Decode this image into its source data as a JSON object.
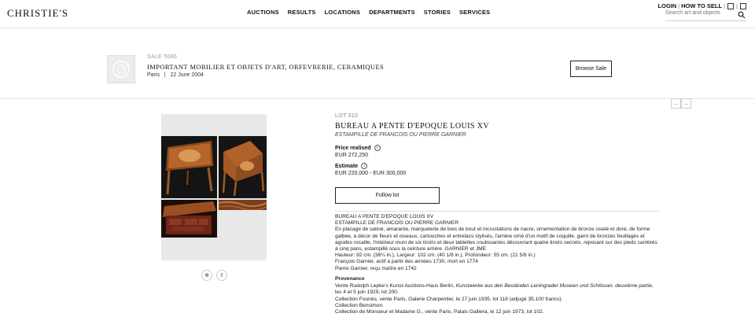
{
  "header": {
    "logo": "CHRISTIE'S",
    "nav": [
      "AUCTIONS",
      "RESULTS",
      "LOCATIONS",
      "DEPARTMENTS",
      "STORIES",
      "SERVICES"
    ],
    "login": "LOGIN",
    "how_to_sell": "HOW TO SELL",
    "search_placeholder": "Search art and objects"
  },
  "sale": {
    "number": "SALE 5086",
    "title": "IMPORTANT MOBILIER ET OBJETS D'ART, ORFEVRERIE, CERAMIQUES",
    "location": "Paris",
    "separator": "|",
    "date": "22 June 2004",
    "browse_label": "Browse Sale"
  },
  "pager": {
    "prev": "←",
    "next": "→"
  },
  "lot": {
    "number": "LOT 310",
    "title": "BUREAU A PENTE D'EPOQUE LOUIS XV",
    "subtitle": "ESTAMPILLE DE FRANCOIS OU PIERRE GARNIER",
    "price_label": "Price realised",
    "price_value": "EUR 272,250",
    "estimate_label": "Estimate",
    "estimate_value": "EUR 220,000 - EUR 300,000",
    "follow_label": "Follow lot"
  },
  "description": {
    "lines": [
      "BUREAU A PENTE D'EPOQUE LOUIS XV",
      "ESTAMPILLE DE FRANCOIS OU PIERRE GARNIER",
      "En placage de satiné, amarante, marqueterie de bois de bout et incrustations de nacre, ornementation de bronze ciselé et doré, de forme galbée, à décor de fleurs et oiseaux, cartouches et entrelacs stylisés, l'arrière orné d'un motif de coquille, garni de bronzes feuillagés et agrafes rocaille, l'intérieur muni de six tiroirs et deux tablettes coulissantes découvrant quatre tiroirs secrets, reposant sur des pieds cambrés à cinq pans, estampillé sous la ceinture arrière .GARNIER et JME",
      "Hauteur: 92 cm. (36¼ in.), Largeur: 102 cm. (40 1/8 in.), Profondeur: 55 cm. (21 5/8 in.)",
      "François Garnier, actif à partir des années 1730, mort en 1774",
      "Pierre Garnier, reçu maître en 1742"
    ]
  },
  "provenance": {
    "heading": "Provenance",
    "line1_a": "Vente Rudolph Lepke's Kunst-Auctions-Haus Berlin, ",
    "line1_italic": "Kunstwerke aus den Beständen Leningrader Museen und Schlösser, deuxième partie",
    "line1_b": ", les 4 et 5 juin 1929, lot 200.",
    "line2": "Collection Founès, vente Paris, Galerie Charpentier, le 27 juin 1935, lot 118 (adjugé 35.100 francs).",
    "line3": "Collection Bensimon.",
    "line4": "Collection de Monsieur et Madame G., vente Paris, Palais Galliera, le 12 juin 1973, lot 102."
  },
  "colors": {
    "border": "#222222",
    "divider": "#dddddd",
    "gallery_bg": "#e8e8e8"
  }
}
